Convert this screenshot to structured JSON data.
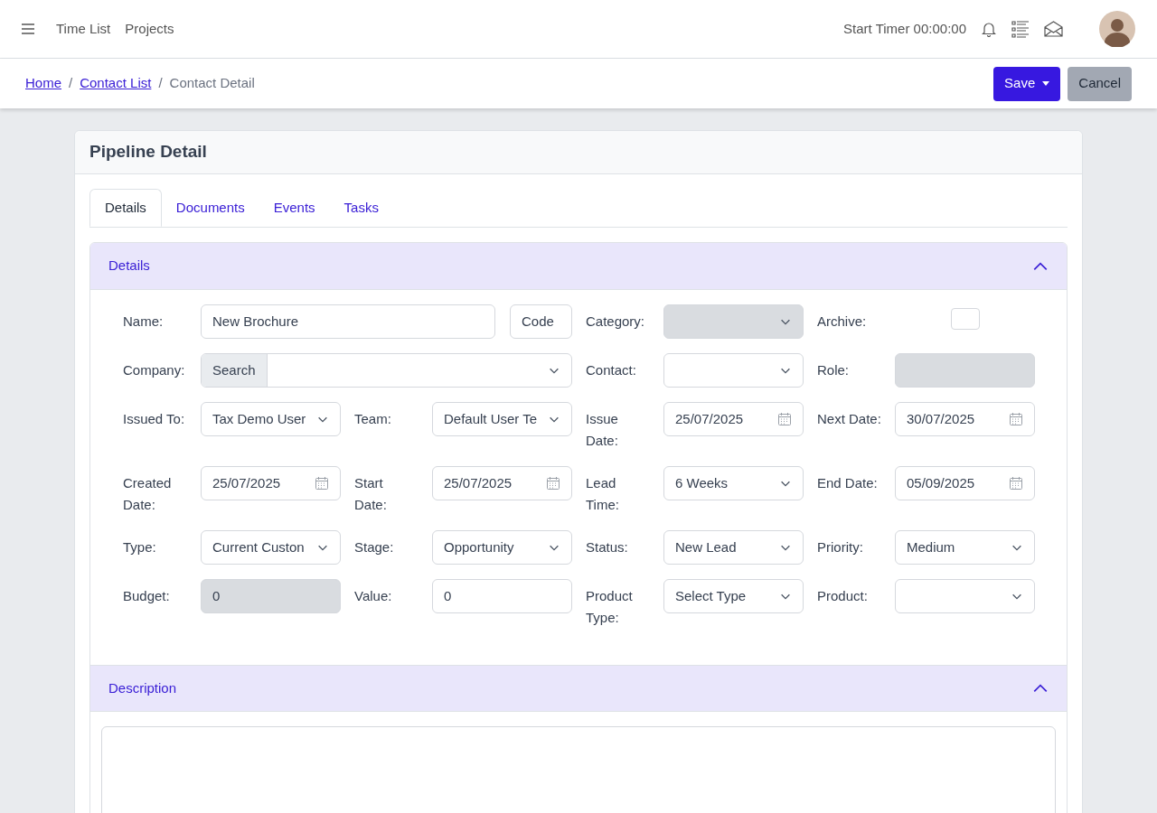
{
  "topbar": {
    "nav": [
      "Time List",
      "Projects"
    ],
    "timer": "Start Timer 00:00:00"
  },
  "breadcrumb_separator": "/",
  "breadcrumb": [
    {
      "label": "Home",
      "link": true
    },
    {
      "label": "Contact List",
      "link": true
    },
    {
      "label": "Contact Detail",
      "link": false
    }
  ],
  "actions": {
    "save": "Save",
    "cancel": "Cancel"
  },
  "card": {
    "title": "Pipeline Detail",
    "tabs": [
      {
        "label": "Details",
        "selected": true
      },
      {
        "label": "Documents",
        "selected": false
      },
      {
        "label": "Events",
        "selected": false
      },
      {
        "label": "Tasks",
        "selected": false
      }
    ],
    "sections": [
      {
        "title": "Details",
        "expanded": true,
        "kind": "form",
        "rows": [
          [
            {
              "label": "Name:",
              "kind": "name_code",
              "value": "New Brochure",
              "placeholder": "Code",
              "disabled": false
            },
            {
              "label": "Category:",
              "kind": "select",
              "disabled": true
            },
            {
              "label": "Archive:",
              "kind": "checkbox",
              "checked": false
            }
          ],
          [
            {
              "label": "Company:",
              "kind": "search_select",
              "addon": "Search",
              "disabled": false
            },
            {
              "label": "Contact:",
              "kind": "select",
              "disabled": false
            },
            {
              "label": "Role:",
              "kind": "text",
              "disabled": true
            }
          ],
          [
            {
              "label": "Issued To:",
              "kind": "select",
              "value": "Tax Demo User",
              "disabled": false
            },
            {
              "label": "Team:",
              "kind": "select",
              "value": "Default User Te",
              "disabled": false
            },
            {
              "label": "Issue Date:",
              "kind": "date",
              "value": "25/07/2025",
              "disabled": false
            },
            {
              "label": "Next Date:",
              "kind": "date",
              "value": "30/07/2025",
              "disabled": false
            }
          ],
          [
            {
              "label": "Created Date:",
              "kind": "date",
              "value": "25/07/2025",
              "disabled": false
            },
            {
              "label": "Start Date:",
              "kind": "date",
              "value": "25/07/2025",
              "disabled": false
            },
            {
              "label": "Lead Time:",
              "kind": "select",
              "value": "6 Weeks",
              "disabled": false
            },
            {
              "label": "End Date:",
              "kind": "date",
              "value": "05/09/2025",
              "disabled": false
            }
          ],
          [
            {
              "label": "Type:",
              "kind": "select",
              "value": "Current Custon",
              "disabled": false
            },
            {
              "label": "Stage:",
              "kind": "select",
              "value": "Opportunity",
              "disabled": false
            },
            {
              "label": "Status:",
              "kind": "select",
              "value": "New Lead",
              "disabled": false
            },
            {
              "label": "Priority:",
              "kind": "select",
              "value": "Medium",
              "disabled": false
            }
          ],
          [
            {
              "label": "Budget:",
              "kind": "text",
              "value": "0",
              "disabled": true
            },
            {
              "label": "Value:",
              "kind": "text",
              "value": "0",
              "disabled": false
            },
            {
              "label": "Product Type:",
              "kind": "select",
              "value": "Select Type",
              "disabled": false
            },
            {
              "label": "Product:",
              "kind": "select",
              "disabled": false
            }
          ]
        ]
      },
      {
        "title": "Description",
        "expanded": true,
        "kind": "textarea"
      }
    ]
  }
}
